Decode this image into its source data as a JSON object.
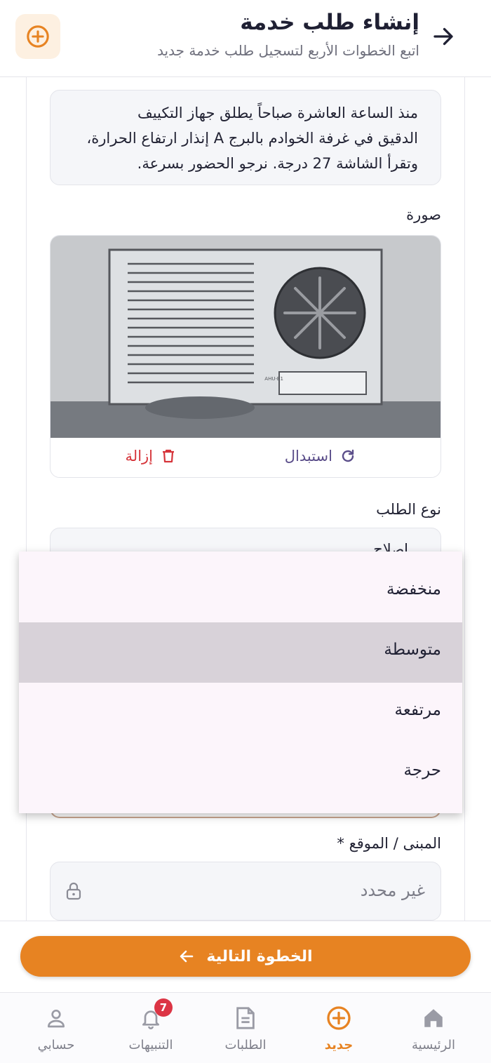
{
  "header": {
    "title": "إنشاء طلب خدمة",
    "subtitle": "اتبع الخطوات الأربع لتسجيل طلب خدمة جديد"
  },
  "description": {
    "lines": [
      "منذ الساعة العاشرة صباحاً يطلق جهاز التكييف",
      "الدقيق في غرفة الخوادم بالبرج A إنذار ارتفاع الحرارة،",
      "وتقرأ الشاشة 27 درجة. نرجو الحضور بسرعة."
    ]
  },
  "photo": {
    "label": "صورة",
    "unit_tag": "AHU-B1",
    "replace_label": "استبدال",
    "remove_label": "إزالة"
  },
  "request_type": {
    "label": "نوع الطلب",
    "value": "إصلاح"
  },
  "priority_dropdown": {
    "options": [
      "منخفضة",
      "متوسطة",
      "مرتفعة",
      "حرجة"
    ],
    "selected": "متوسطة"
  },
  "location": {
    "label": "المبنى / الموقع *",
    "value": "غير محدد"
  },
  "next_button": {
    "label": "الخطوة التالية"
  },
  "bottom_nav": {
    "home": "الرئيسية",
    "new": "جديد",
    "requests": "الطلبات",
    "notifications": "التنبيهات",
    "notifications_badge": "7",
    "account": "حسابي"
  },
  "colors": {
    "accent": "#e78322",
    "danger": "#d6343a",
    "replace": "#5b4e8a"
  }
}
